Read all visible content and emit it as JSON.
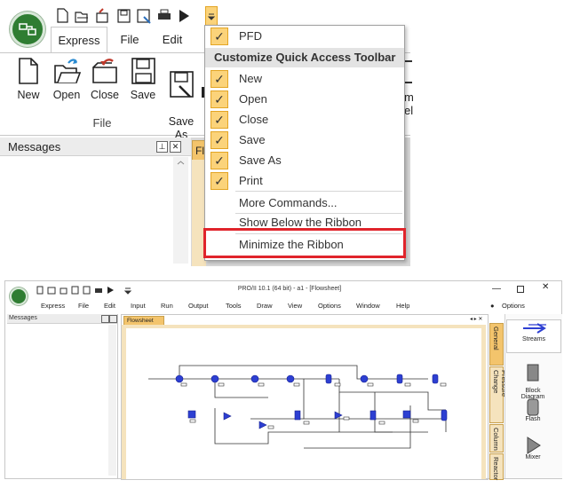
{
  "top": {
    "tabs": [
      "Express",
      "File",
      "Edit"
    ],
    "ribbon_buttons": [
      {
        "label": "New",
        "icon": "new-file-icon"
      },
      {
        "label": "Open",
        "icon": "open-folder-icon"
      },
      {
        "label": "Close",
        "icon": "close-file-icon"
      },
      {
        "label": "Save",
        "icon": "save-icon"
      },
      {
        "label": "Save\nAs",
        "icon": "save-as-icon"
      }
    ],
    "group_label": "File",
    "messages_title": "Messages",
    "flowsheet_tab_partial": "Fl"
  },
  "menu": {
    "pfd": "PFD",
    "header": "Customize Quick Access Toolbar",
    "items": [
      "New",
      "Open",
      "Close",
      "Save",
      "Save As",
      "Print"
    ],
    "more": "More Commands...",
    "show_below": "Show Below the Ribbon",
    "minimize": "Minimize the Ribbon",
    "check": "✓"
  },
  "bottom": {
    "title": "PRO/II 10.1 (64 bit) - a1 - [Flowsheet]",
    "menu": [
      "Express",
      "File",
      "Edit",
      "Input",
      "Run",
      "Output",
      "Tools",
      "Draw",
      "View",
      "Options",
      "Window",
      "Help"
    ],
    "options_label": "Options",
    "messages": "Messages",
    "flowsheet_tab": "Flowsheet",
    "side_tabs": [
      "General",
      "Pressure Change",
      "Column",
      "Reactor"
    ],
    "palette": [
      "Streams",
      "Block\nDiagram",
      "Flash",
      "Mixer"
    ],
    "accent": "#f3c46c",
    "highlight_color": "#e0242b"
  }
}
